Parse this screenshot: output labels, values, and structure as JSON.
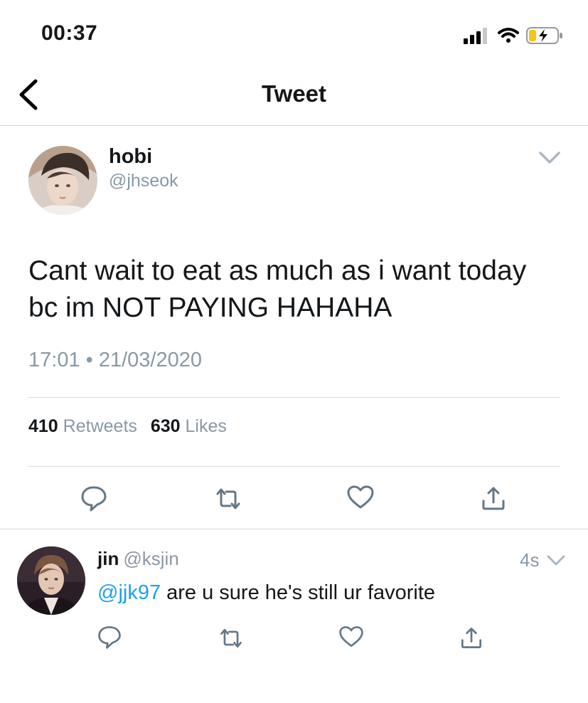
{
  "status_bar": {
    "time": "00:37",
    "icons": [
      "cellular-signal-icon",
      "wifi-icon",
      "battery-charging-icon"
    ],
    "battery_color": "#f5c518"
  },
  "nav": {
    "title": "Tweet",
    "back_icon": "chevron-left-icon"
  },
  "tweet": {
    "author_name": "hobi",
    "author_handle": "@jhseok",
    "text_line1": "Cant wait to eat as much as i want today",
    "text_line2": "bc im NOT PAYING HAHAHA",
    "timestamp": "17:01 • 21/03/2020",
    "retweet_count": "410",
    "retweet_label": "Retweets",
    "like_count": "630",
    "like_label": "Likes",
    "actions": [
      "reply-icon",
      "retweet-icon",
      "like-icon",
      "share-icon"
    ]
  },
  "reply": {
    "author_name": "jin",
    "author_handle": "@ksjin",
    "time": "4s",
    "mention": "@jjk97",
    "text": " are u sure he's still ur favorite",
    "actions": [
      "reply-icon",
      "retweet-icon",
      "like-icon",
      "share-icon"
    ]
  },
  "colors": {
    "accent": "#1da1f2",
    "muted": "#8899a6",
    "text": "#14171a",
    "icon": "#657786"
  }
}
